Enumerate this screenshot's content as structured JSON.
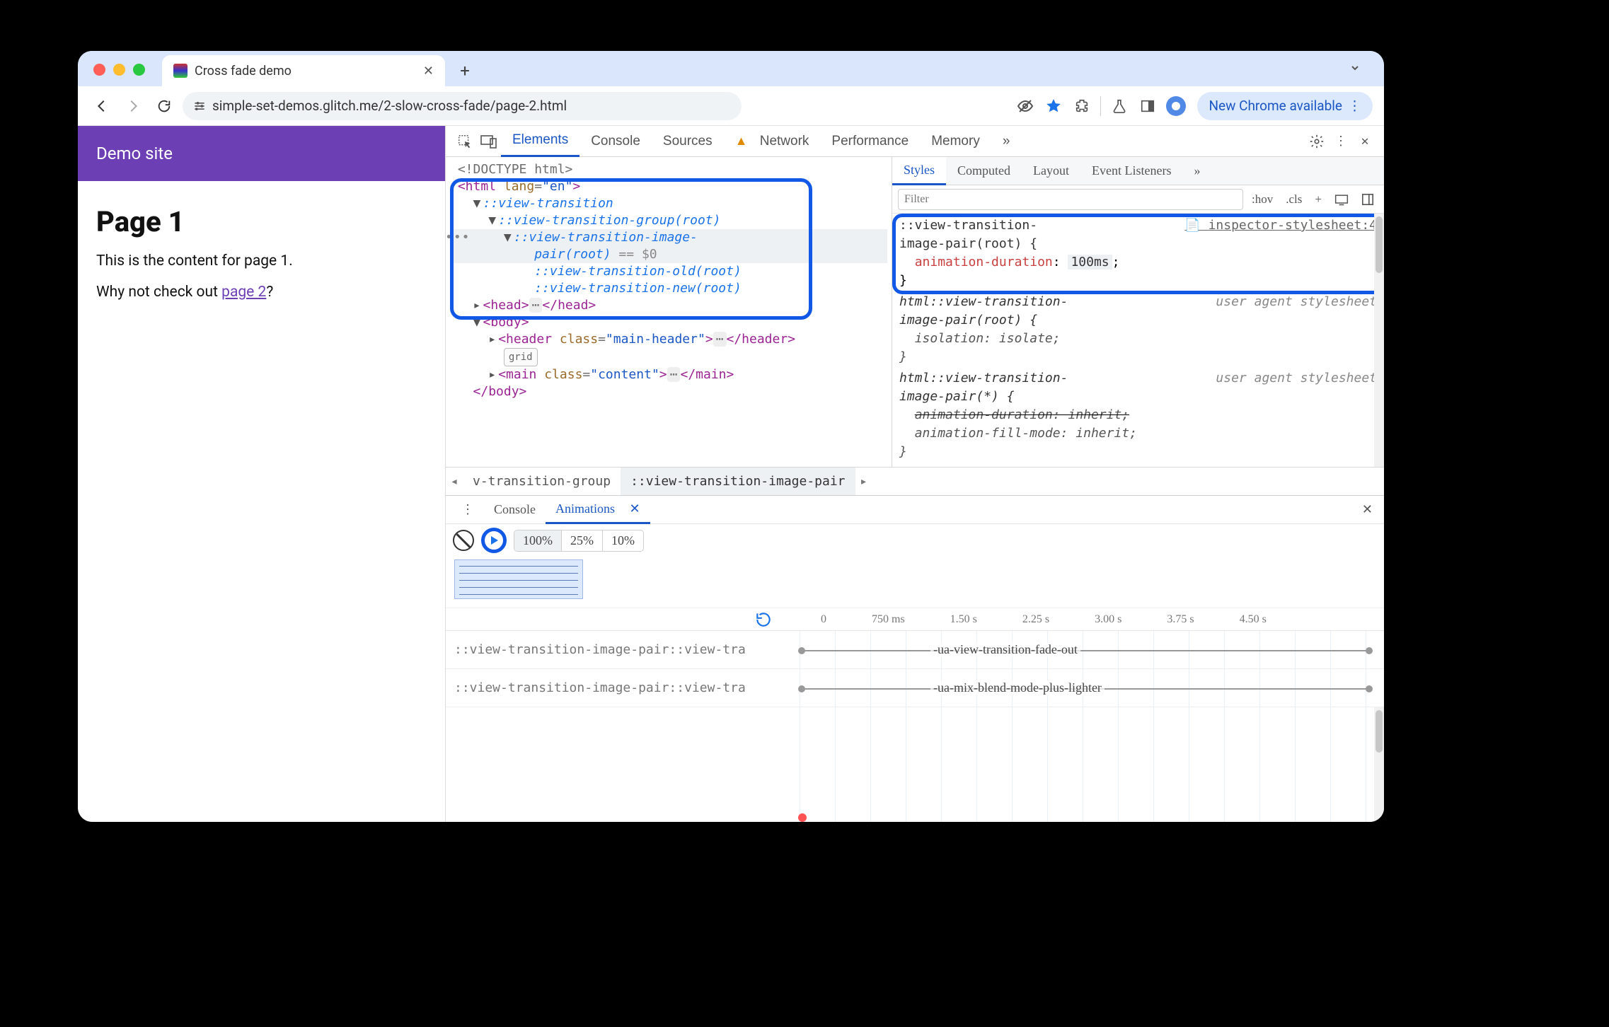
{
  "browser": {
    "tab_title": "Cross fade demo",
    "url": "simple-set-demos.glitch.me/2-slow-cross-fade/page-2.html",
    "update_pill": "New Chrome available"
  },
  "page": {
    "site_title": "Demo site",
    "heading": "Page 1",
    "p1": "This is the content for page 1.",
    "p2_pre": "Why not check out ",
    "p2_link": "page 2",
    "p2_post": "?"
  },
  "devtools": {
    "tabs": [
      "Elements",
      "Console",
      "Sources",
      "Network",
      "Performance",
      "Memory"
    ],
    "more": "»",
    "dom": {
      "doctype": "<!DOCTYPE html>",
      "html_open": "<html lang=\"en\">",
      "vt": "::view-transition",
      "vtg": "::view-transition-group(root)",
      "vtip": "::view-transition-image-pair(root)",
      "dollar0": " == $0",
      "vto": "::view-transition-old(root)",
      "vtn": "::view-transition-new(root)",
      "head": "<head>…</head>",
      "body_open": "<body>",
      "header_line": "<header class=\"main-header\">…</header>",
      "grid_chip": "grid",
      "main_line": "<main class=\"content\">…</main>",
      "body_close": "</body>"
    },
    "docked_ellipsis": "…",
    "breadcrumbs": [
      "v-transition-group",
      "::view-transition-image-pair"
    ],
    "styles": {
      "tabs": [
        "Styles",
        "Computed",
        "Layout",
        "Event Listeners"
      ],
      "more": "»",
      "filter_placeholder": "Filter",
      "ctrls": [
        ":hov",
        ".cls",
        "+"
      ],
      "rule1": {
        "selector": "::view-transition-image-pair(root) {",
        "src": "inspector-stylesheet:4",
        "prop": "animation-duration",
        "val": "100ms"
      },
      "rule2": {
        "selector": "html::view-transition-image-pair(root) {",
        "src": "user agent stylesheet",
        "props": [
          [
            "isolation",
            "isolate"
          ]
        ]
      },
      "rule3": {
        "selector": "html::view-transition-image-pair(*) {",
        "src": "user agent stylesheet",
        "props": [
          [
            "animation-duration",
            "inherit",
            true
          ],
          [
            "animation-fill-mode",
            "inherit",
            false
          ]
        ]
      }
    }
  },
  "drawer": {
    "tabs": [
      "Console",
      "Animations"
    ],
    "speed": [
      "100%",
      "25%",
      "10%"
    ],
    "ruler": [
      "0",
      "750 ms",
      "1.50 s",
      "2.25 s",
      "3.00 s",
      "3.75 s",
      "4.50 s"
    ],
    "tracks": [
      {
        "sel": "::view-transition-image-pair::view-tra",
        "name": "-ua-view-transition-fade-out"
      },
      {
        "sel": "::view-transition-image-pair::view-tra",
        "name": "-ua-mix-blend-mode-plus-lighter"
      }
    ]
  }
}
